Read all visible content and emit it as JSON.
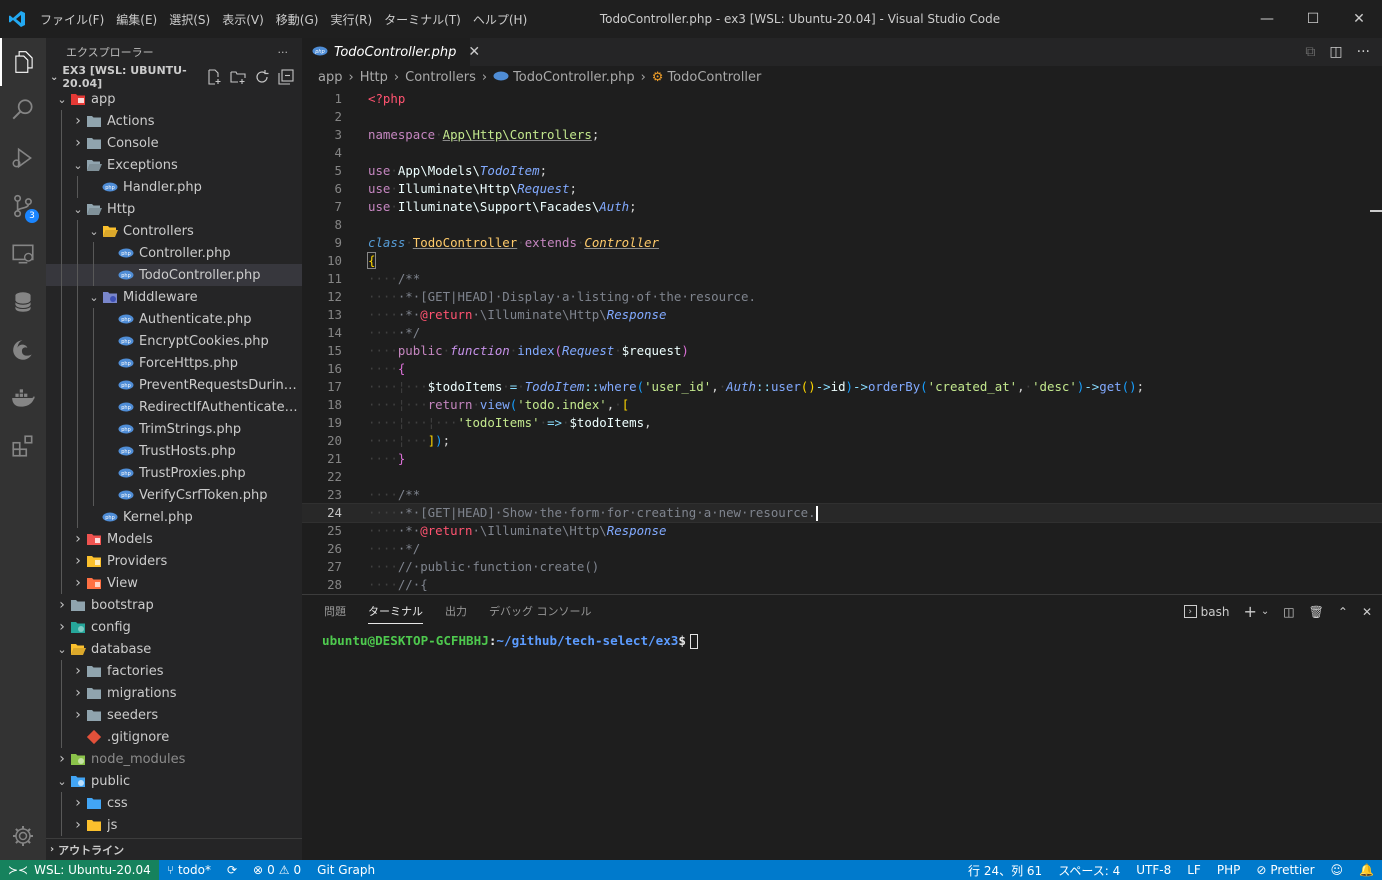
{
  "titlebar": {
    "menus": [
      "ファイル(F)",
      "編集(E)",
      "選択(S)",
      "表示(V)",
      "移動(G)",
      "実行(R)",
      "ターミナル(T)",
      "ヘルプ(H)"
    ],
    "window_title": "TodoController.php - ex3 [WSL: Ubuntu-20.04] - Visual Studio Code",
    "minimize": "—",
    "maximize": "☐",
    "close": "✕"
  },
  "activity": {
    "icons": [
      "explorer-icon",
      "search-icon",
      "run-debug-icon",
      "source-control-icon",
      "remote-explorer-icon",
      "database-icon",
      "edge-icon",
      "docker-icon",
      "extensions-icon"
    ],
    "source_control_badge": "3",
    "bottom_icon": "settings-gear-icon"
  },
  "sidebar": {
    "title": "エクスプローラー",
    "more": "···",
    "workspace": "EX3 [WSL: UBUNTU-20.04]",
    "outline": "アウトライン",
    "tree": [
      {
        "label": "app",
        "depth": 1,
        "chev": "open",
        "icon": "folder-app"
      },
      {
        "label": "Actions",
        "depth": 2,
        "chev": "closed",
        "icon": "folder"
      },
      {
        "label": "Console",
        "depth": 2,
        "chev": "closed",
        "icon": "folder"
      },
      {
        "label": "Exceptions",
        "depth": 2,
        "chev": "open",
        "icon": "folder-open"
      },
      {
        "label": "Handler.php",
        "depth": 3,
        "chev": "none",
        "icon": "php"
      },
      {
        "label": "Http",
        "depth": 2,
        "chev": "open",
        "icon": "folder-open"
      },
      {
        "label": "Controllers",
        "depth": 3,
        "chev": "open",
        "icon": "folder-controllers"
      },
      {
        "label": "Controller.php",
        "depth": 4,
        "chev": "none",
        "icon": "php"
      },
      {
        "label": "TodoController.php",
        "depth": 4,
        "chev": "none",
        "icon": "php",
        "selected": true
      },
      {
        "label": "Middleware",
        "depth": 3,
        "chev": "open",
        "icon": "folder-middleware"
      },
      {
        "label": "Authenticate.php",
        "depth": 4,
        "chev": "none",
        "icon": "php"
      },
      {
        "label": "EncryptCookies.php",
        "depth": 4,
        "chev": "none",
        "icon": "php"
      },
      {
        "label": "ForceHttps.php",
        "depth": 4,
        "chev": "none",
        "icon": "php"
      },
      {
        "label": "PreventRequestsDuring...",
        "depth": 4,
        "chev": "none",
        "icon": "php"
      },
      {
        "label": "RedirectIfAuthenticated....",
        "depth": 4,
        "chev": "none",
        "icon": "php"
      },
      {
        "label": "TrimStrings.php",
        "depth": 4,
        "chev": "none",
        "icon": "php"
      },
      {
        "label": "TrustHosts.php",
        "depth": 4,
        "chev": "none",
        "icon": "php"
      },
      {
        "label": "TrustProxies.php",
        "depth": 4,
        "chev": "none",
        "icon": "php"
      },
      {
        "label": "VerifyCsrfToken.php",
        "depth": 4,
        "chev": "none",
        "icon": "php"
      },
      {
        "label": "Kernel.php",
        "depth": 3,
        "chev": "none",
        "icon": "php"
      },
      {
        "label": "Models",
        "depth": 2,
        "chev": "closed",
        "icon": "folder-models"
      },
      {
        "label": "Providers",
        "depth": 2,
        "chev": "closed",
        "icon": "folder-providers"
      },
      {
        "label": "View",
        "depth": 2,
        "chev": "closed",
        "icon": "folder-view"
      },
      {
        "label": "bootstrap",
        "depth": 1,
        "chev": "closed",
        "icon": "folder"
      },
      {
        "label": "config",
        "depth": 1,
        "chev": "closed",
        "icon": "folder-config"
      },
      {
        "label": "database",
        "depth": 1,
        "chev": "open",
        "icon": "folder-database"
      },
      {
        "label": "factories",
        "depth": 2,
        "chev": "closed",
        "icon": "folder"
      },
      {
        "label": "migrations",
        "depth": 2,
        "chev": "closed",
        "icon": "folder"
      },
      {
        "label": "seeders",
        "depth": 2,
        "chev": "closed",
        "icon": "folder"
      },
      {
        "label": ".gitignore",
        "depth": 2,
        "chev": "none",
        "icon": "git"
      },
      {
        "label": "node_modules",
        "depth": 1,
        "chev": "closed",
        "icon": "folder-node",
        "dim": true
      },
      {
        "label": "public",
        "depth": 1,
        "chev": "open",
        "icon": "folder-public"
      },
      {
        "label": "css",
        "depth": 2,
        "chev": "closed",
        "icon": "folder-css"
      },
      {
        "label": "js",
        "depth": 2,
        "chev": "closed",
        "icon": "folder-js"
      }
    ]
  },
  "editor": {
    "tab_label": "TodoController.php",
    "tab_close": "✕",
    "breadcrumb": [
      "app",
      "Http",
      "Controllers",
      "TodoController.php",
      "TodoController"
    ],
    "current_line": 24
  },
  "panel": {
    "tabs": [
      "問題",
      "ターミナル",
      "出力",
      "デバッグ コンソール"
    ],
    "active_tab": "ターミナル",
    "shell": "bash",
    "prompt_user": "ubuntu@DESKTOP-GCFHBHJ",
    "prompt_colon": ":",
    "prompt_path": "~/github/tech-select/ex3",
    "prompt_end": "$"
  },
  "statusbar": {
    "remote": "WSL: Ubuntu-20.04",
    "branch": "todo*",
    "errors": "0",
    "warnings": "0",
    "git_graph": "Git Graph",
    "position": "行 24、列 61",
    "spaces": "スペース: 4",
    "encoding": "UTF-8",
    "eol": "LF",
    "language": "PHP",
    "prettier": "Prettier"
  },
  "colors": {
    "statusbar": "#007acc",
    "remote": "#16825d",
    "activity": "#333333",
    "sidebar": "#252526",
    "editor": "#1e1e1e"
  }
}
